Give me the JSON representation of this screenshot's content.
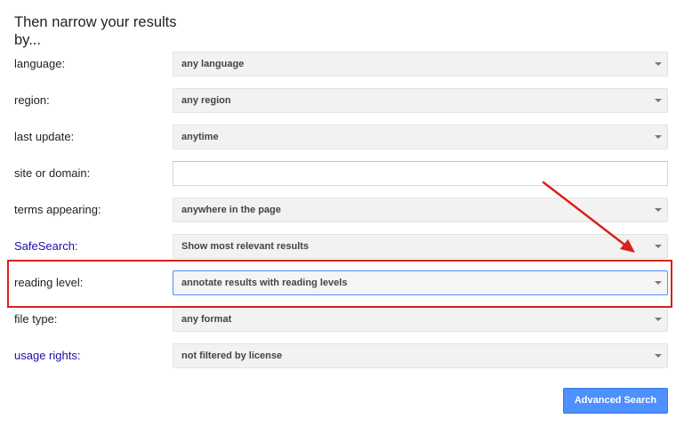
{
  "heading": "Then narrow your results by...",
  "rows": [
    {
      "label": "language:",
      "value": "any language"
    },
    {
      "label": "region:",
      "value": "any region"
    },
    {
      "label": "last update:",
      "value": "anytime"
    },
    {
      "label": "site or domain:",
      "value": ""
    },
    {
      "label": "terms appearing:",
      "value": "anywhere in the page"
    },
    {
      "label": "SafeSearch:",
      "value": "Show most relevant results"
    },
    {
      "label": "reading level:",
      "value": "annotate results with reading levels"
    },
    {
      "label": "file type:",
      "value": "any format"
    },
    {
      "label": "usage rights:",
      "value": "not filtered by license"
    }
  ],
  "button": {
    "label": "Advanced Search"
  },
  "colors": {
    "annotation": "#d9201c",
    "button": "#4d90fe",
    "link": "#1a0dab"
  }
}
